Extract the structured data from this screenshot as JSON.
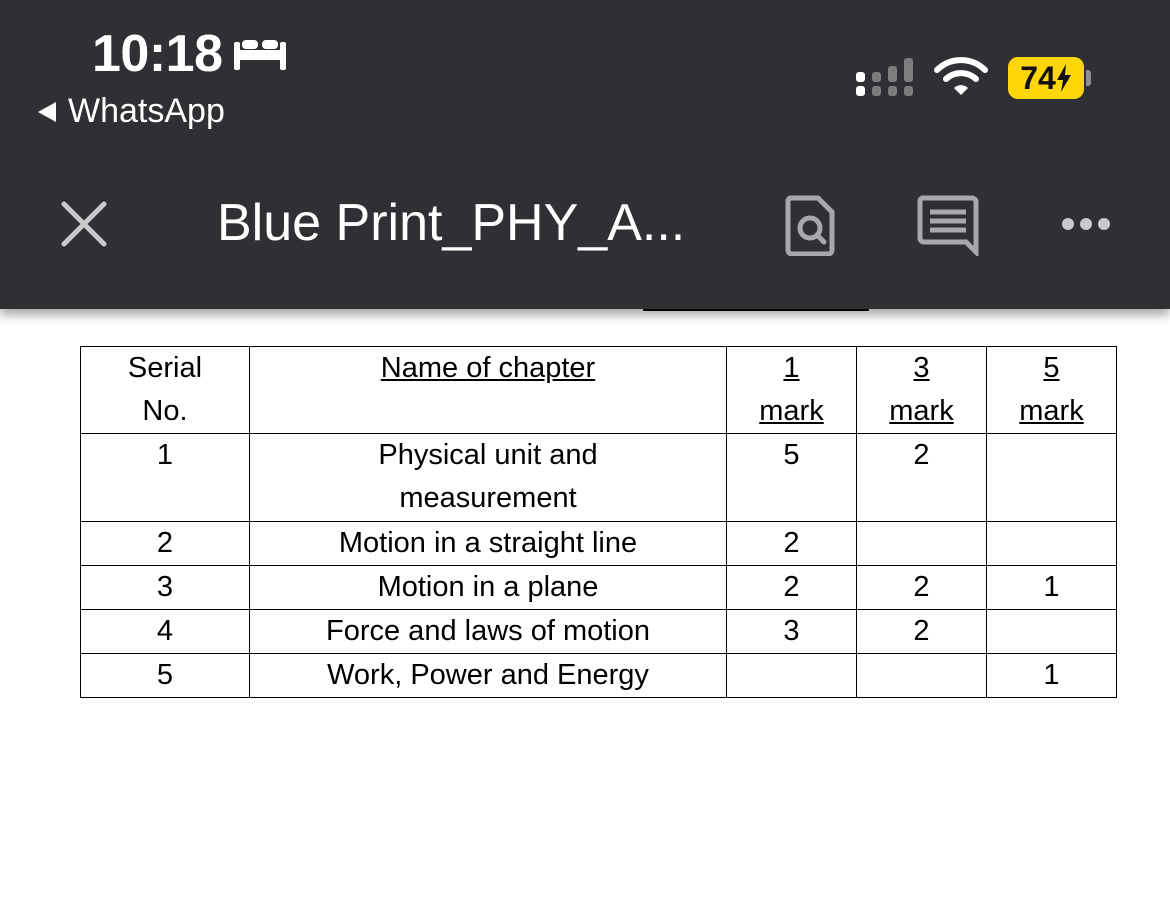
{
  "status_bar": {
    "time": "10:18",
    "back_app": "WhatsApp",
    "battery": "74"
  },
  "toolbar": {
    "title": "Blue Print_PHY_A..."
  },
  "table": {
    "headers": {
      "serial_line1": "Serial",
      "serial_line2": "No.",
      "chapter": "Name of chapter",
      "one_num": "1",
      "three_num": "3",
      "five_num": "5",
      "mark": "mark"
    },
    "rows": [
      {
        "serial": "1",
        "chapter_line1": "Physical unit and",
        "chapter_line2": "measurement",
        "one": "5",
        "three": "2",
        "five": ""
      },
      {
        "serial": "2",
        "chapter": "Motion in a straight line",
        "one": "2",
        "three": "",
        "five": ""
      },
      {
        "serial": "3",
        "chapter": "Motion in a plane",
        "one": "2",
        "three": "2",
        "five": "1"
      },
      {
        "serial": "4",
        "chapter": "Force and laws of motion",
        "one": "3",
        "three": "2",
        "five": ""
      },
      {
        "serial": "5",
        "chapter": "Work, Power and Energy",
        "one": "",
        "three": "",
        "five": "1"
      }
    ]
  }
}
